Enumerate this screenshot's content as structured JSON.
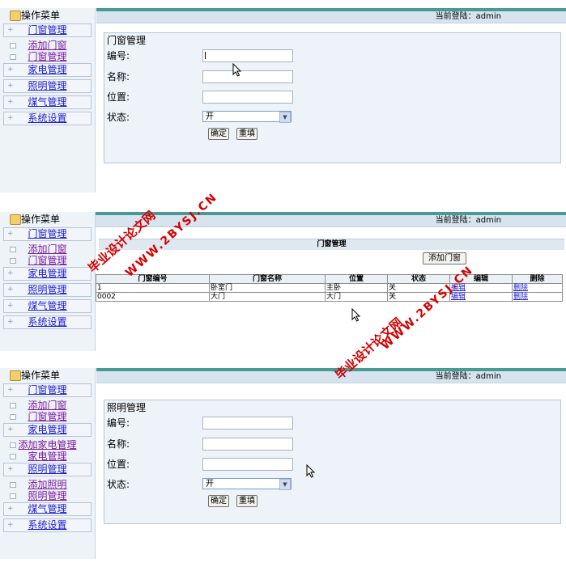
{
  "sidebar": {
    "title": "操作菜单",
    "p1": {
      "door": "门窗管理",
      "add_door": "添加门窗",
      "door_manage": "门窗管理",
      "appliance": "家电管理",
      "lighting": "照明管理",
      "gas": "煤气管理",
      "system": "系统设置"
    },
    "p3": {
      "door": "门窗管理",
      "add_door": "添加门窗",
      "door_manage": "门窗管理",
      "appliance": "家电管理",
      "add_appliance": "添加家电管理",
      "appliance_manage": "家电管理",
      "lighting": "照明管理",
      "add_light": "添加照明",
      "light_manage": "照明管理",
      "gas": "煤气管理",
      "system": "系统设置"
    }
  },
  "header": {
    "login": "当前登陆：admin"
  },
  "door_form": {
    "title": "门窗管理",
    "label_no": "编号:",
    "label_name": "名称:",
    "label_loc": "位置:",
    "label_state": "状态:",
    "state_value": "开",
    "confirm": "确定",
    "reset": "重填"
  },
  "door_list": {
    "title": "门窗管理",
    "add_button": "添加门窗",
    "columns": [
      "门窗编号",
      "门窗名称",
      "位置",
      "状态",
      "编辑",
      "删除"
    ],
    "rows": [
      {
        "no": "1",
        "name": "卧室门",
        "loc": "主卧",
        "state": "关",
        "edit": "编辑",
        "del": "删除"
      },
      {
        "no": "0002",
        "name": "大门",
        "loc": "大门",
        "state": "关",
        "edit": "编辑",
        "del": "删除"
      }
    ]
  },
  "light_form": {
    "title": "照明管理",
    "label_no": "编号:",
    "label_name": "名称:",
    "label_loc": "位置:",
    "label_state": "状态:",
    "state_value": "开",
    "confirm": "确定",
    "reset": "重填"
  },
  "watermark": {
    "cn": "毕业设计论文网",
    "url": "WWW.2BYSJ.CN"
  },
  "colors": {
    "accent": "#4a9a94",
    "watermark": "#d40000",
    "link": "#1b1bd6"
  }
}
